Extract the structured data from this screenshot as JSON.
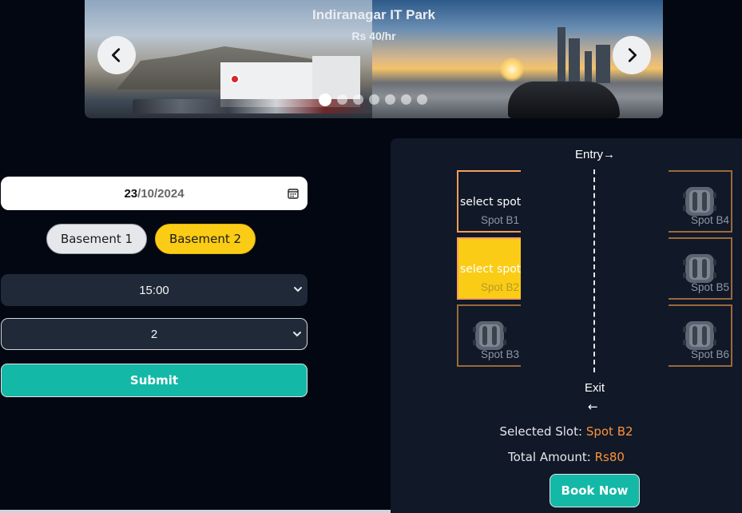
{
  "carousel": {
    "title": "Indiranagar IT Park",
    "price": "Rs 40/hr",
    "dot_count": 7,
    "active_dot": 0,
    "prev_icon": "chevron-left-icon",
    "next_icon": "chevron-right-icon"
  },
  "form": {
    "date": {
      "day": "23",
      "month": "10",
      "year": "2024",
      "sep": "/"
    },
    "basements": [
      {
        "label": "Basement 1",
        "selected": false
      },
      {
        "label": "Basement 2",
        "selected": true
      }
    ],
    "time_value": "15:00",
    "hours_value": "2",
    "submit_label": "Submit"
  },
  "parking": {
    "entry_label": "Entry→",
    "exit_label": "Exit",
    "exit_arrow": "←",
    "select_text": "select spot",
    "spots": [
      {
        "name": "Spot B1",
        "occupied": false,
        "selected": false
      },
      {
        "name": "Spot B2",
        "occupied": false,
        "selected": true
      },
      {
        "name": "Spot B3",
        "occupied": true,
        "selected": false
      },
      {
        "name": "Spot B4",
        "occupied": true,
        "selected": false
      },
      {
        "name": "Spot B5",
        "occupied": true,
        "selected": false
      },
      {
        "name": "Spot B6",
        "occupied": true,
        "selected": false
      }
    ]
  },
  "summary": {
    "slot_label": "Selected Slot: ",
    "slot_value": "Spot B2",
    "amount_label": "Total Amount: ",
    "amount_value": "Rs80"
  },
  "book_label": "Book Now",
  "colors": {
    "accent_teal": "#14b8a6",
    "selected_yellow": "#facc15",
    "highlight_orange": "#fb923c"
  }
}
